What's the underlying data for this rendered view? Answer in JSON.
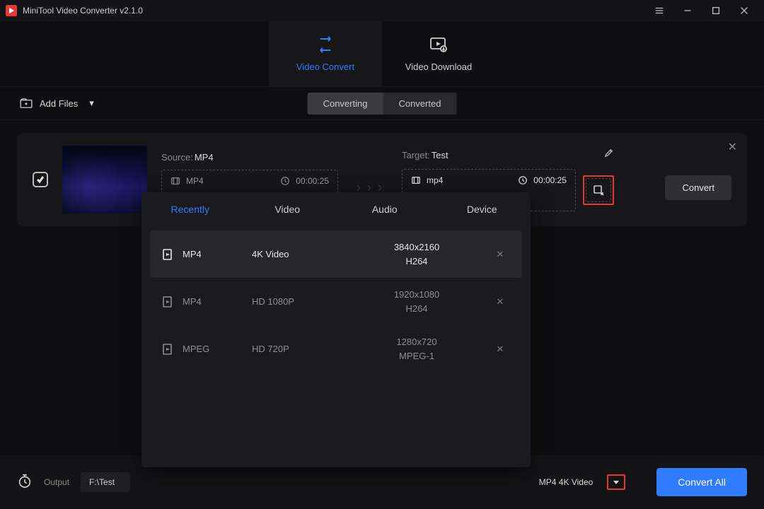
{
  "title": "MiniTool Video Converter v2.1.0",
  "header": {
    "tabs": [
      {
        "label": "Video Convert",
        "active": true
      },
      {
        "label": "Video Download",
        "active": false
      }
    ]
  },
  "toolbar": {
    "add_files": "Add Files",
    "subtabs": [
      {
        "label": "Converting",
        "active": true
      },
      {
        "label": "Converted",
        "active": false
      }
    ]
  },
  "item": {
    "source_label": "Source:",
    "source_value": "MP4",
    "source_format": "MP4",
    "source_duration": "00:00:25",
    "target_label": "Target:",
    "target_value": "Test",
    "target_format": "mp4",
    "target_duration": "00:00:25",
    "convert_label": "Convert"
  },
  "popup": {
    "tabs": [
      "Recently",
      "Video",
      "Audio",
      "Device"
    ],
    "active_tab": 0,
    "rows": [
      {
        "format": "MP4",
        "quality": "4K Video",
        "res": "3840x2160",
        "codec": "H264",
        "active": true
      },
      {
        "format": "MP4",
        "quality": "HD 1080P",
        "res": "1920x1080",
        "codec": "H264",
        "active": false
      },
      {
        "format": "MPEG",
        "quality": "HD 720P",
        "res": "1280x720",
        "codec": "MPEG-1",
        "active": false
      }
    ]
  },
  "footer": {
    "output_label": "Output",
    "output_path": "F:\\Test",
    "preset": "MP4 4K Video",
    "convert_all": "Convert All"
  }
}
